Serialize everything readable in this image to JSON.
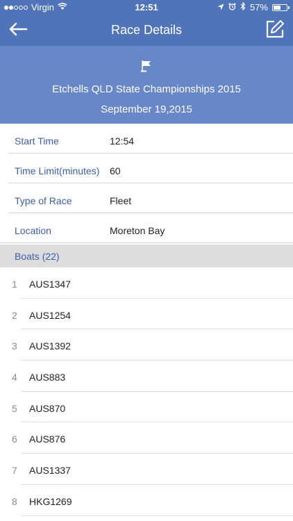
{
  "status_bar": {
    "carrier": "Virgin",
    "time": "12:51",
    "battery_percent": "57%",
    "battery_level": 0.57,
    "signal_bars_full": 2,
    "signal_bars_total": 5
  },
  "nav": {
    "title": "Race Details",
    "back_icon": "back-arrow-icon",
    "edit_icon": "edit-icon"
  },
  "race": {
    "name": "Etchells QLD State Championships 2015",
    "date": "September 19,2015",
    "icon": "flag-icon"
  },
  "details": [
    {
      "label": "Start Time",
      "value": "12:54"
    },
    {
      "label": "Time Limit(minutes)",
      "value": "60"
    },
    {
      "label": "Type of Race",
      "value": "Fleet"
    },
    {
      "label": "Location",
      "value": "Moreton Bay"
    }
  ],
  "boats": {
    "header": "Boats (22)",
    "items": [
      {
        "num": "1",
        "name": "AUS1347"
      },
      {
        "num": "2",
        "name": "AUS1254"
      },
      {
        "num": "3",
        "name": "AUS1392"
      },
      {
        "num": "4",
        "name": "AUS883"
      },
      {
        "num": "5",
        "name": "AUS870"
      },
      {
        "num": "6",
        "name": "AUS876"
      },
      {
        "num": "7",
        "name": "AUS1337"
      },
      {
        "num": "8",
        "name": "HKG1269"
      }
    ]
  },
  "colors": {
    "nav_background": "#4f74ba",
    "banner_background": "#6787c9",
    "label_text": "#3d5ea8",
    "section_background": "#dcdcdc"
  }
}
